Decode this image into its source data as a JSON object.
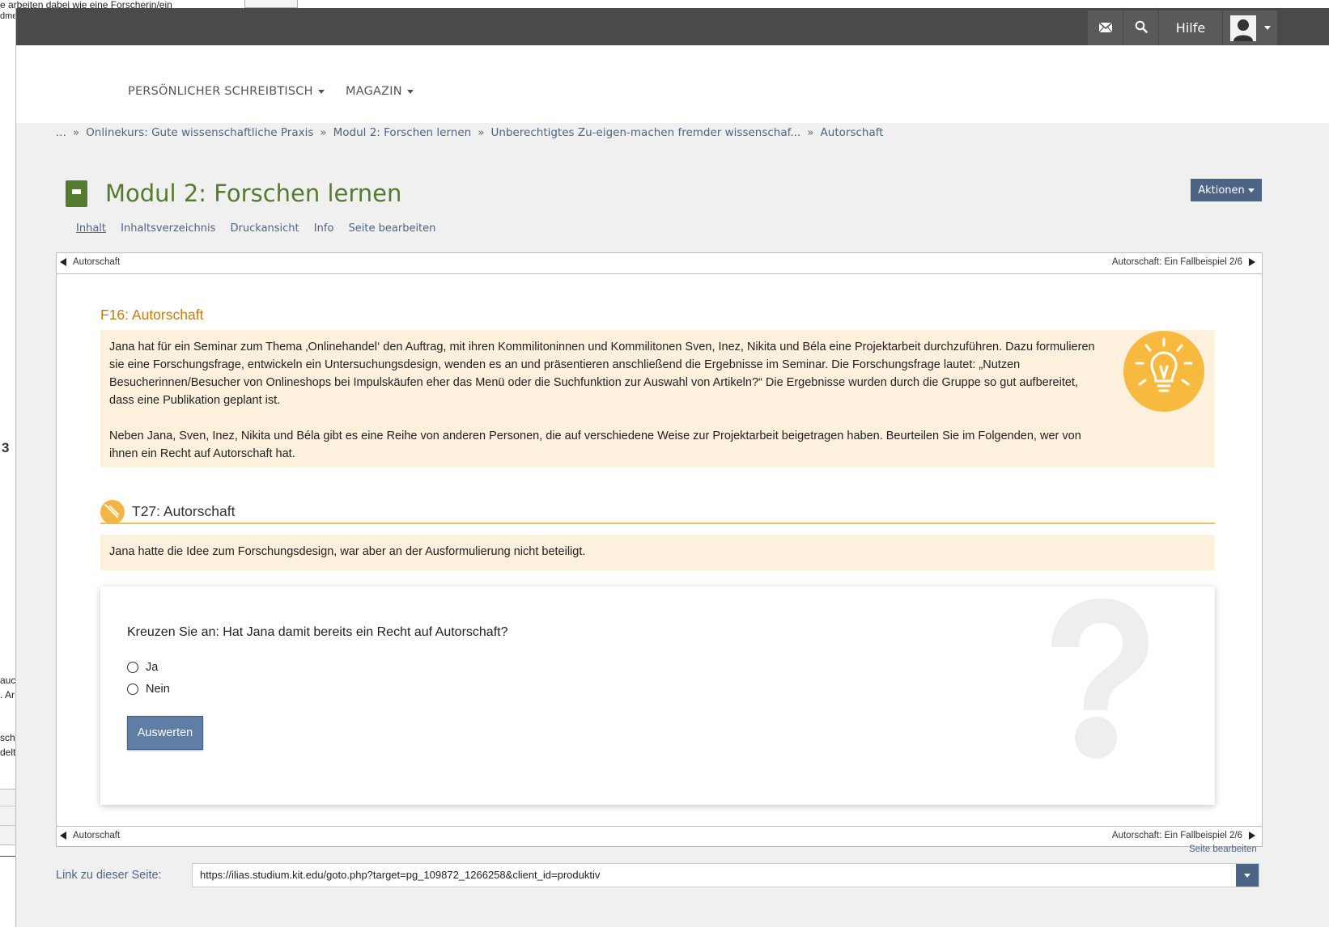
{
  "background": {
    "fragments": [
      "e arbeiten dabei wie eine Forscherin/ein",
      "dme",
      "3",
      "auc",
      ". Ar",
      "sch",
      "delt"
    ]
  },
  "topbar": {
    "mail_icon": "mail-icon",
    "search_icon": "search-icon",
    "help_label": "Hilfe",
    "avatar_icon": "user-avatar-icon"
  },
  "nav": {
    "items": [
      {
        "label": "PERSÖNLICHER SCHREIBTISCH"
      },
      {
        "label": "MAGAZIN"
      }
    ]
  },
  "breadcrumb": {
    "items": [
      "...",
      "Onlinekurs: Gute wissenschaftliche Praxis",
      "Modul 2: Forschen lernen",
      "Unberechtigtes Zu-eigen-machen fremder wissenschaf...",
      "Autorschaft"
    ],
    "separator": "»"
  },
  "header": {
    "title": "Modul 2: Forschen lernen",
    "actions_label": "Aktionen"
  },
  "tabs": [
    {
      "label": "Inhalt",
      "active": true
    },
    {
      "label": "Inhaltsverzeichnis"
    },
    {
      "label": "Druckansicht"
    },
    {
      "label": "Info"
    },
    {
      "label": "Seite bearbeiten"
    }
  ],
  "pagenav": {
    "prev_label": "Autorschaft",
    "next_label": "Autorschaft: Ein Fallbeispiel 2/6"
  },
  "case": {
    "heading": "F16: Autorschaft",
    "paragraph1": "Jana hat für ein Seminar zum Thema ‚Onlinehandel‘ den Auftrag, mit ihren Kommilitoninnen und Kommilitonen Sven, Inez, Nikita und Béla eine Projektarbeit durchzuführen. Dazu formulieren sie eine Forschungsfrage, entwickeln ein Untersuchungsdesign, wenden es an und präsentieren anschließend die Ergebnisse im Seminar. Die Forschungsfrage lautet: „Nutzen Besucherinnen/Besucher von Onlineshops bei Impulskäufen eher das Menü oder die Suchfunktion zur Auswahl von Artikeln?“ Die Ergebnisse wurden durch die Gruppe so gut aufbereitet, dass eine Publikation geplant ist.",
    "paragraph2": "Neben Jana, Sven, Inez, Nikita und Béla gibt es eine Reihe von anderen Personen, die auf verschiedene Weise zur Projektarbeit beigetragen haben. Beurteilen Sie im Folgenden, wer von ihnen ein Recht auf Autorschaft hat.",
    "icon": "lightbulb-icon"
  },
  "task": {
    "heading": "T27: Autorschaft",
    "icon": "pencil-icon",
    "statement": "Jana hatte die Idee zum Forschungsdesign, war aber an der Ausformulierung nicht beteiligt."
  },
  "question": {
    "text": "Kreuzen Sie an: Hat Jana damit bereits ein Recht auf Autorschaft?",
    "options": [
      "Ja",
      "Nein"
    ],
    "submit_label": "Auswerten",
    "icon": "question-mark-icon"
  },
  "footer": {
    "edit_label": "Seite bearbeiten",
    "link_label": "Link zu dieser Seite:",
    "link_value": "https://ilias.studium.kit.edu/goto.php?target=pg_109872_1266258&client_id=produktiv"
  },
  "colors": {
    "accent_green": "#557b2e",
    "link_blue": "#4c6586",
    "heading_orange": "#c87a10",
    "panel_beige": "#fdf0dc",
    "icon_yellow": "#f7ba3e"
  }
}
